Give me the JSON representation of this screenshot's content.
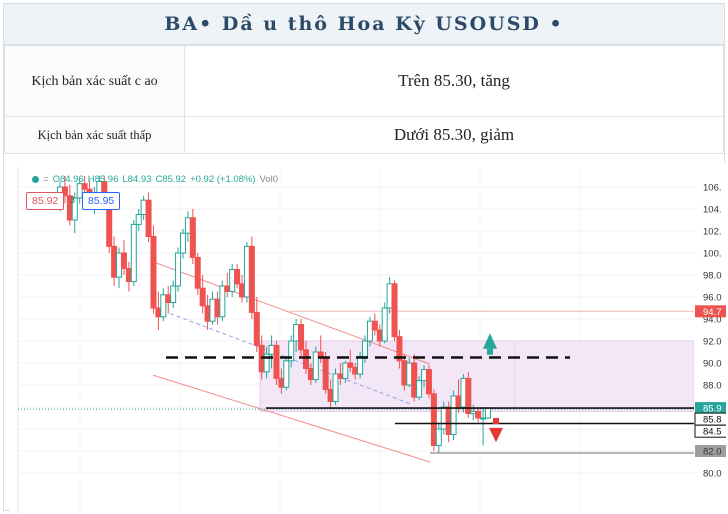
{
  "header": {
    "title": "BA•  Dầ u thô Hoa Kỳ   USOUSD  •"
  },
  "scenarios": [
    {
      "label": "Kịch bản xác suất c ao",
      "value": "Trên 85.30, tăng"
    },
    {
      "label": "Kịch bản xác suất thấp",
      "value": "Dưới 85.30, giảm"
    }
  ],
  "chart": {
    "ohlc": {
      "open": "O84.96",
      "high": "H85.96",
      "low": "L84.93",
      "close": "C85.92",
      "change": "+0.92 (+1.08%)",
      "volume": "Vol0"
    },
    "sell_price": "85.92",
    "spread": "3",
    "buy_price": "85.95",
    "y_ticks": [
      "106.",
      "104.",
      "102.",
      "100.",
      "98.0",
      "96.0",
      "94.0",
      "92.0",
      "90.0",
      "88.0",
      "86.0",
      "84.0",
      "82.0",
      "80.0"
    ],
    "y_labels_tagged": [
      {
        "text": "94.7",
        "color": "#ef5350"
      },
      {
        "text": "85.9",
        "color": "#26a69a"
      },
      {
        "text": "85.8",
        "color": "#111111"
      },
      {
        "text": "84.5",
        "color": "#111111"
      },
      {
        "text": "82.0",
        "color": "#9e9e9e"
      }
    ],
    "colors": {
      "up": "#26a69a",
      "down": "#ef5350",
      "zone": "#f3e6f6",
      "channel": "#f28a8a",
      "trend": "#8ea6e8"
    }
  },
  "chart_data": {
    "type": "candlestick",
    "ylim": [
      80,
      107
    ],
    "y_ticks": [
      106,
      104,
      102,
      100,
      98,
      96,
      94,
      92,
      90,
      88,
      86,
      84,
      82,
      80
    ],
    "candles": [
      [
        104.8,
        106.5,
        103.8,
        106.0
      ],
      [
        106.0,
        107.0,
        104.5,
        105.2
      ],
      [
        105.2,
        106.2,
        102.5,
        103.0
      ],
      [
        103.0,
        105.5,
        101.8,
        105.0
      ],
      [
        105.0,
        106.8,
        104.5,
        106.3
      ],
      [
        106.3,
        107.0,
        105.2,
        105.8
      ],
      [
        105.8,
        106.6,
        104.0,
        104.6
      ],
      [
        104.6,
        106.0,
        103.5,
        105.4
      ],
      [
        105.4,
        107.0,
        104.8,
        106.5
      ],
      [
        106.5,
        107.0,
        104.0,
        104.5
      ],
      [
        104.5,
        105.0,
        100.0,
        100.6
      ],
      [
        100.6,
        101.5,
        97.0,
        97.8
      ],
      [
        97.8,
        100.5,
        96.8,
        100.0
      ],
      [
        100.0,
        101.2,
        98.0,
        98.6
      ],
      [
        98.6,
        99.2,
        96.5,
        97.4
      ],
      [
        97.4,
        103.0,
        97.0,
        102.6
      ],
      [
        102.6,
        104.0,
        102.0,
        103.5
      ],
      [
        103.5,
        105.2,
        103.0,
        104.8
      ],
      [
        104.8,
        105.5,
        101.0,
        101.5
      ],
      [
        101.5,
        102.5,
        94.5,
        95.0
      ],
      [
        95.0,
        96.5,
        93.0,
        94.2
      ],
      [
        94.2,
        96.8,
        93.8,
        96.2
      ],
      [
        96.2,
        97.0,
        94.5,
        95.5
      ],
      [
        95.5,
        97.5,
        95.0,
        97.0
      ],
      [
        97.0,
        100.5,
        96.5,
        100.0
      ],
      [
        100.0,
        102.2,
        99.5,
        101.8
      ],
      [
        101.8,
        103.8,
        101.0,
        103.2
      ],
      [
        103.2,
        104.0,
        99.0,
        99.6
      ],
      [
        99.6,
        100.0,
        96.2,
        96.8
      ],
      [
        96.8,
        98.0,
        94.5,
        95.2
      ],
      [
        95.2,
        96.2,
        93.0,
        93.8
      ],
      [
        93.8,
        96.5,
        93.5,
        95.8
      ],
      [
        95.8,
        96.5,
        93.5,
        94.2
      ],
      [
        94.2,
        97.5,
        93.8,
        97.0
      ],
      [
        97.0,
        98.2,
        96.0,
        96.5
      ],
      [
        96.5,
        99.0,
        96.0,
        98.5
      ],
      [
        98.5,
        99.0,
        96.8,
        97.2
      ],
      [
        97.2,
        98.0,
        95.5,
        96.0
      ],
      [
        96.0,
        101.0,
        95.5,
        100.6
      ],
      [
        100.6,
        101.5,
        94.0,
        94.6
      ],
      [
        94.6,
        96.0,
        91.0,
        91.6
      ],
      [
        91.6,
        92.5,
        88.5,
        89.2
      ],
      [
        89.2,
        91.5,
        88.6,
        90.8
      ],
      [
        90.8,
        92.5,
        89.5,
        91.6
      ],
      [
        91.6,
        92.0,
        88.0,
        88.6
      ],
      [
        88.6,
        89.5,
        87.2,
        87.8
      ],
      [
        87.8,
        90.5,
        87.5,
        90.2
      ],
      [
        90.2,
        92.5,
        89.6,
        92.0
      ],
      [
        92.0,
        94.0,
        91.0,
        93.5
      ],
      [
        93.5,
        94.0,
        90.5,
        91.2
      ],
      [
        91.2,
        92.0,
        89.0,
        89.5
      ],
      [
        89.5,
        90.0,
        88.0,
        88.5
      ],
      [
        88.5,
        91.5,
        88.2,
        91.0
      ],
      [
        91.0,
        92.5,
        90.0,
        90.5
      ],
      [
        90.5,
        91.0,
        87.2,
        87.6
      ],
      [
        87.6,
        88.5,
        86.0,
        86.5
      ],
      [
        86.5,
        89.5,
        86.2,
        89.0
      ],
      [
        89.0,
        90.0,
        88.0,
        88.6
      ],
      [
        88.6,
        90.2,
        88.2,
        90.0
      ],
      [
        90.0,
        91.2,
        89.2,
        89.6
      ],
      [
        89.6,
        90.0,
        88.5,
        89.0
      ],
      [
        89.0,
        91.0,
        88.6,
        90.6
      ],
      [
        90.6,
        92.5,
        90.0,
        92.0
      ],
      [
        92.0,
        94.2,
        91.5,
        93.8
      ],
      [
        93.8,
        94.5,
        92.5,
        93.0
      ],
      [
        93.0,
        93.5,
        91.5,
        92.0
      ],
      [
        92.0,
        95.5,
        91.8,
        95.0
      ],
      [
        95.0,
        97.8,
        94.5,
        97.2
      ],
      [
        97.2,
        97.5,
        92.0,
        92.4
      ],
      [
        92.4,
        93.0,
        89.5,
        90.2
      ],
      [
        90.2,
        90.8,
        87.5,
        88.0
      ],
      [
        88.0,
        90.5,
        87.8,
        90.0
      ],
      [
        90.0,
        90.8,
        86.5,
        86.9
      ],
      [
        86.9,
        88.8,
        86.6,
        88.4
      ],
      [
        88.4,
        89.8,
        87.8,
        89.4
      ],
      [
        89.4,
        89.8,
        86.8,
        87.2
      ],
      [
        87.2,
        87.6,
        82.0,
        82.5
      ],
      [
        82.5,
        84.5,
        81.8,
        84.0
      ],
      [
        84.0,
        86.5,
        83.5,
        86.0
      ],
      [
        86.0,
        86.5,
        82.8,
        83.5
      ],
      [
        83.5,
        87.5,
        83.0,
        87.0
      ],
      [
        87.0,
        88.5,
        85.5,
        86.0
      ],
      [
        86.0,
        89.0,
        85.5,
        88.6
      ],
      [
        88.6,
        89.2,
        85.0,
        85.4
      ],
      [
        85.4,
        86.2,
        84.8,
        85.6
      ],
      [
        85.6,
        86.0,
        84.6,
        85.0
      ],
      [
        85.0,
        86.0,
        82.5,
        85.0
      ],
      [
        85.0,
        86.0,
        84.9,
        85.9
      ]
    ],
    "levels": {
      "resistance_dashed": 90.5,
      "support_line_1": 85.9,
      "support_line_2": 84.5,
      "grey_line": 82.0,
      "red_line": 94.7,
      "zone": [
        85.6,
        92.0
      ]
    }
  }
}
